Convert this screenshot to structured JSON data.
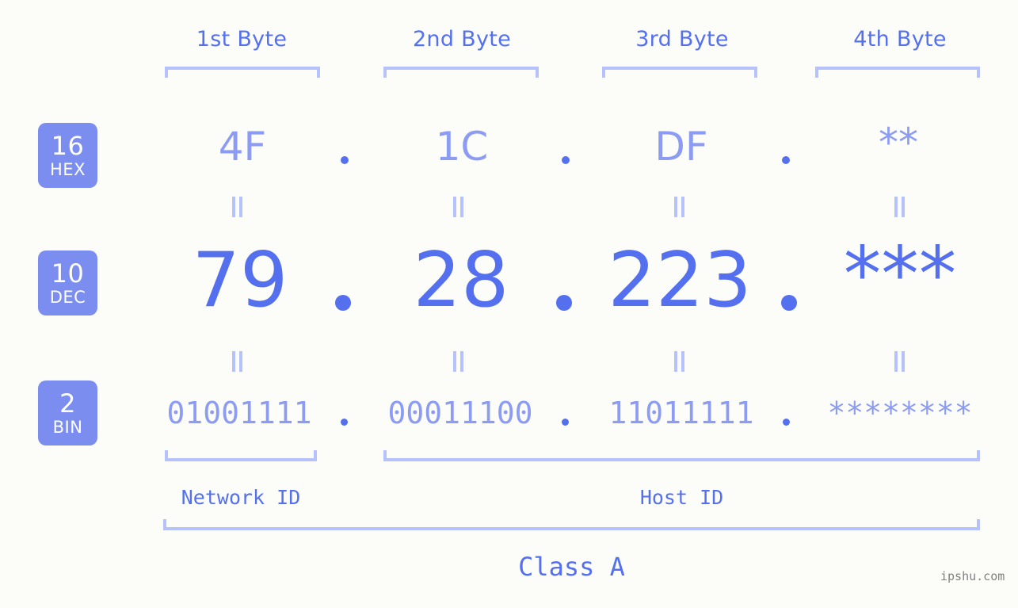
{
  "byte_headers": [
    {
      "label": "1st Byte"
    },
    {
      "label": "2nd Byte"
    },
    {
      "label": "3rd Byte"
    },
    {
      "label": "4th Byte"
    }
  ],
  "badges": [
    {
      "base": "16",
      "name": "HEX"
    },
    {
      "base": "10",
      "name": "DEC"
    },
    {
      "base": "2",
      "name": "BIN"
    }
  ],
  "rows": {
    "hex": {
      "octets": [
        "4F",
        "1C",
        "DF",
        "**"
      ]
    },
    "dec": {
      "octets": [
        "79",
        "28",
        "223",
        "***"
      ]
    },
    "bin": {
      "octets": [
        "01001111",
        "00011100",
        "11011111",
        "********"
      ]
    }
  },
  "separator": ".",
  "equals_mark": "=",
  "segments": {
    "network_id": "Network ID",
    "host_id": "Host ID",
    "class": "Class A"
  },
  "watermark": "ipshu.com",
  "colors": {
    "background": "#fcfdf8",
    "accent_strong": "#5570ee",
    "accent_light": "#8c9cf3",
    "bracket": "#b6c2fb",
    "badge_fill": "#7b8ef0",
    "badge_text": "#ffffff",
    "watermark": "#808080"
  }
}
